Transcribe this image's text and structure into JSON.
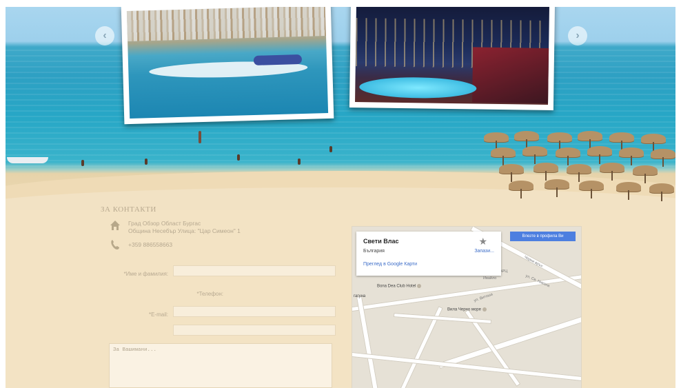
{
  "contacts": {
    "title": "ЗА КОНТАКТИ",
    "address_line1": "Град Обзор Област Бургас",
    "address_line2": "Община Несебър Улица: \"Цар Симеон\" 1",
    "phone": "+359 886558663",
    "icons": {
      "address": "home-icon",
      "phone": "phone-icon"
    }
  },
  "form": {
    "name_label": "*Име и фамилия:",
    "phone_label": "*Телефон:",
    "email_label": "*E-mail:",
    "message_placeholder": "За Вашимани..."
  },
  "map": {
    "place_title": "Свети Влас",
    "place_country": "България",
    "save_label": "Запази...",
    "view_link": "Преглед в Google Карти",
    "profile_button": "Влезте в профила Ви",
    "poi_1": "Bona Dea Club Hotel",
    "poi_2": "Вила Черно море",
    "street_1": "Черни връх",
    "street_2": "Ивайло",
    "street_3": "ПАРЦ",
    "street_4": "ул. Св. Никола",
    "street_5": "ул. Витоша",
    "left_text": "гагуна"
  },
  "slider": {
    "prev_icon": "chevron-left-icon",
    "next_icon": "chevron-right-icon",
    "prev_glyph": "‹",
    "next_glyph": "›"
  },
  "colors": {
    "sand": "#f3e3c4",
    "sea": "#2ea0c3",
    "accent_link": "#3b6cc8",
    "map_button": "#4d7fe0"
  }
}
